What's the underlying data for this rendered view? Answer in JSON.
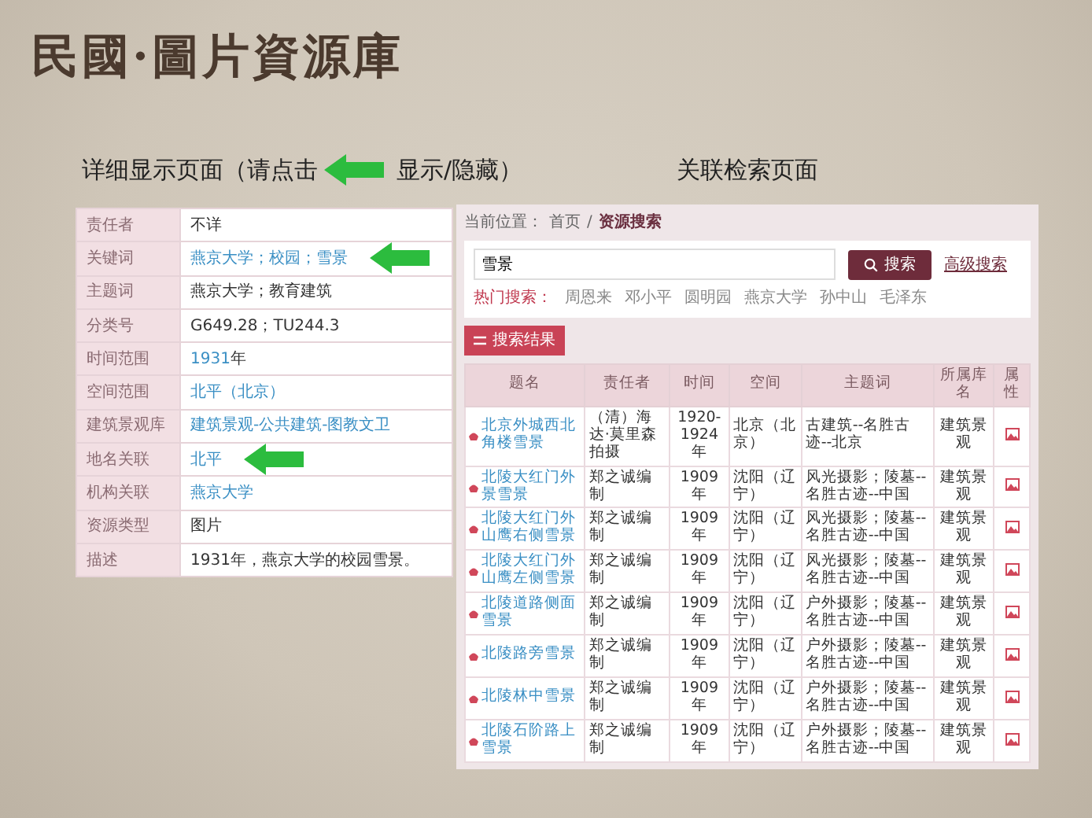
{
  "title": "民國·圖片資源庫",
  "captions": {
    "left_before": "详细显示页面（请点击",
    "left_after": "显示/隐藏）",
    "right": "关联检索页面"
  },
  "detail_table": [
    {
      "label": "责任者",
      "parts": [
        {
          "text": "不详",
          "link": false
        }
      ],
      "arrow": false
    },
    {
      "label": "关键词",
      "parts": [
        {
          "text": "燕京大学；校园；雪景",
          "link": true
        }
      ],
      "arrow": true
    },
    {
      "label": "主题词",
      "parts": [
        {
          "text": "燕京大学；教育建筑",
          "link": false
        }
      ],
      "arrow": false
    },
    {
      "label": "分类号",
      "parts": [
        {
          "text": "G649.28；TU244.3",
          "link": false
        }
      ],
      "arrow": false
    },
    {
      "label": "时间范围",
      "parts": [
        {
          "text": "1931",
          "link": true
        },
        {
          "text": "年",
          "link": false
        }
      ],
      "arrow": false
    },
    {
      "label": "空间范围",
      "parts": [
        {
          "text": "北平（北京）",
          "link": true
        }
      ],
      "arrow": false
    },
    {
      "label": "建筑景观库",
      "parts": [
        {
          "text": "建筑景观-公共建筑-图教文卫",
          "link": true
        }
      ],
      "arrow": false
    },
    {
      "label": "地名关联",
      "parts": [
        {
          "text": "北平",
          "link": true
        }
      ],
      "arrow": true
    },
    {
      "label": "机构关联",
      "parts": [
        {
          "text": "燕京大学",
          "link": true
        }
      ],
      "arrow": false
    },
    {
      "label": "资源类型",
      "parts": [
        {
          "text": "图片",
          "link": false
        }
      ],
      "arrow": false
    },
    {
      "label": "描述",
      "parts": [
        {
          "text": "1931年，燕京大学的校园雪景。",
          "link": false
        }
      ],
      "arrow": false
    }
  ],
  "search_page": {
    "breadcrumb": {
      "label": "当前位置：",
      "separator": "/",
      "items": [
        "首页",
        "资源搜索"
      ]
    },
    "search": {
      "value": "雪景",
      "button": "搜索",
      "advanced": "高级搜索"
    },
    "hot": {
      "label": "热门搜索：",
      "items": [
        "周恩来",
        "邓小平",
        "圆明园",
        "燕京大学",
        "孙中山",
        "毛泽东"
      ]
    },
    "results_button": "搜索结果",
    "table": {
      "columns": [
        "题名",
        "责任者",
        "时间",
        "空间",
        "主题词",
        "所属库名",
        "属性"
      ],
      "rows": [
        [
          "北京外城西北角楼雪景",
          "（清）海达·莫里森拍摄",
          "1920-1924年",
          "北京（北京）",
          "古建筑--名胜古迹--北京",
          "建筑景观"
        ],
        [
          "北陵大红门外景雪景",
          "郑之诚编制",
          "1909年",
          "沈阳（辽宁）",
          "风光摄影；陵墓--名胜古迹--中国",
          "建筑景观"
        ],
        [
          "北陵大红门外山鹰右侧雪景",
          "郑之诚编制",
          "1909年",
          "沈阳（辽宁）",
          "风光摄影；陵墓--名胜古迹--中国",
          "建筑景观"
        ],
        [
          "北陵大红门外山鹰左侧雪景",
          "郑之诚编制",
          "1909年",
          "沈阳（辽宁）",
          "风光摄影；陵墓--名胜古迹--中国",
          "建筑景观"
        ],
        [
          "北陵道路侧面雪景",
          "郑之诚编制",
          "1909年",
          "沈阳（辽宁）",
          "户外摄影；陵墓--名胜古迹--中国",
          "建筑景观"
        ],
        [
          "北陵路旁雪景",
          "郑之诚编制",
          "1909年",
          "沈阳（辽宁）",
          "户外摄影；陵墓--名胜古迹--中国",
          "建筑景观"
        ],
        [
          "北陵林中雪景",
          "郑之诚编制",
          "1909年",
          "沈阳（辽宁）",
          "户外摄影；陵墓--名胜古迹--中国",
          "建筑景观"
        ],
        [
          "北陵石阶路上雪景",
          "郑之诚编制",
          "1909年",
          "沈阳（辽宁）",
          "户外摄影；陵墓--名胜古迹--中国",
          "建筑景观"
        ]
      ]
    }
  }
}
